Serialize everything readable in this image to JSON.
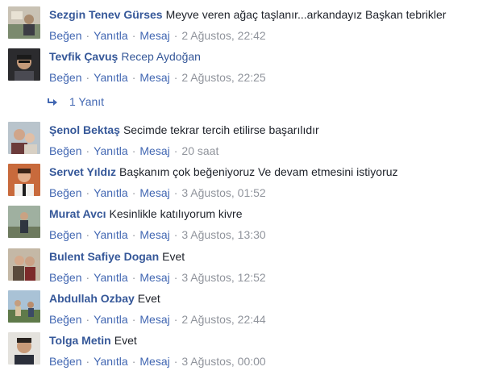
{
  "actions": {
    "like": "Beğen",
    "reply": "Yanıtla",
    "message": "Mesaj",
    "separator": "·"
  },
  "comments": [
    {
      "author": "Sezgin Tenev Gürses",
      "text": "Meyve veren ağaç taşlanır...arkandayız Başkan tebrikler",
      "tag": "",
      "time": "2 Ağustos, 22:42"
    },
    {
      "author": "Tevfik Çavuş",
      "text": "",
      "tag": "Recep Aydoğan",
      "time": "2 Ağustos, 22:25"
    },
    {
      "author": "Şenol Bektaş",
      "text": "Secimde tekrar tercih etilirse başarılıdır",
      "tag": "",
      "time": "20 saat"
    },
    {
      "author": "Servet Yıldız",
      "text": "Başkanım çok beğeniyoruz Ve devam etmesini istiyoruz",
      "tag": "",
      "time": "3 Ağustos, 01:52"
    },
    {
      "author": "Murat Avcı",
      "text": "Kesinlikle katılıyorum kivre",
      "tag": "",
      "time": "3 Ağustos, 13:30"
    },
    {
      "author": "Bulent Safiye Dogan",
      "text": "Evet",
      "tag": "",
      "time": "3 Ağustos, 12:52"
    },
    {
      "author": "Abdullah Ozbay",
      "text": "Evet",
      "tag": "",
      "time": "2 Ağustos, 22:44"
    },
    {
      "author": "Tolga Metin",
      "text": "Evet",
      "tag": "",
      "time": "3 Ağustos, 00:00"
    }
  ],
  "replies_link": {
    "label": "1 Yanıt"
  },
  "colors": {
    "author": "#365899",
    "action": "#4267b2",
    "meta": "#90949c",
    "text": "#1d2129"
  }
}
